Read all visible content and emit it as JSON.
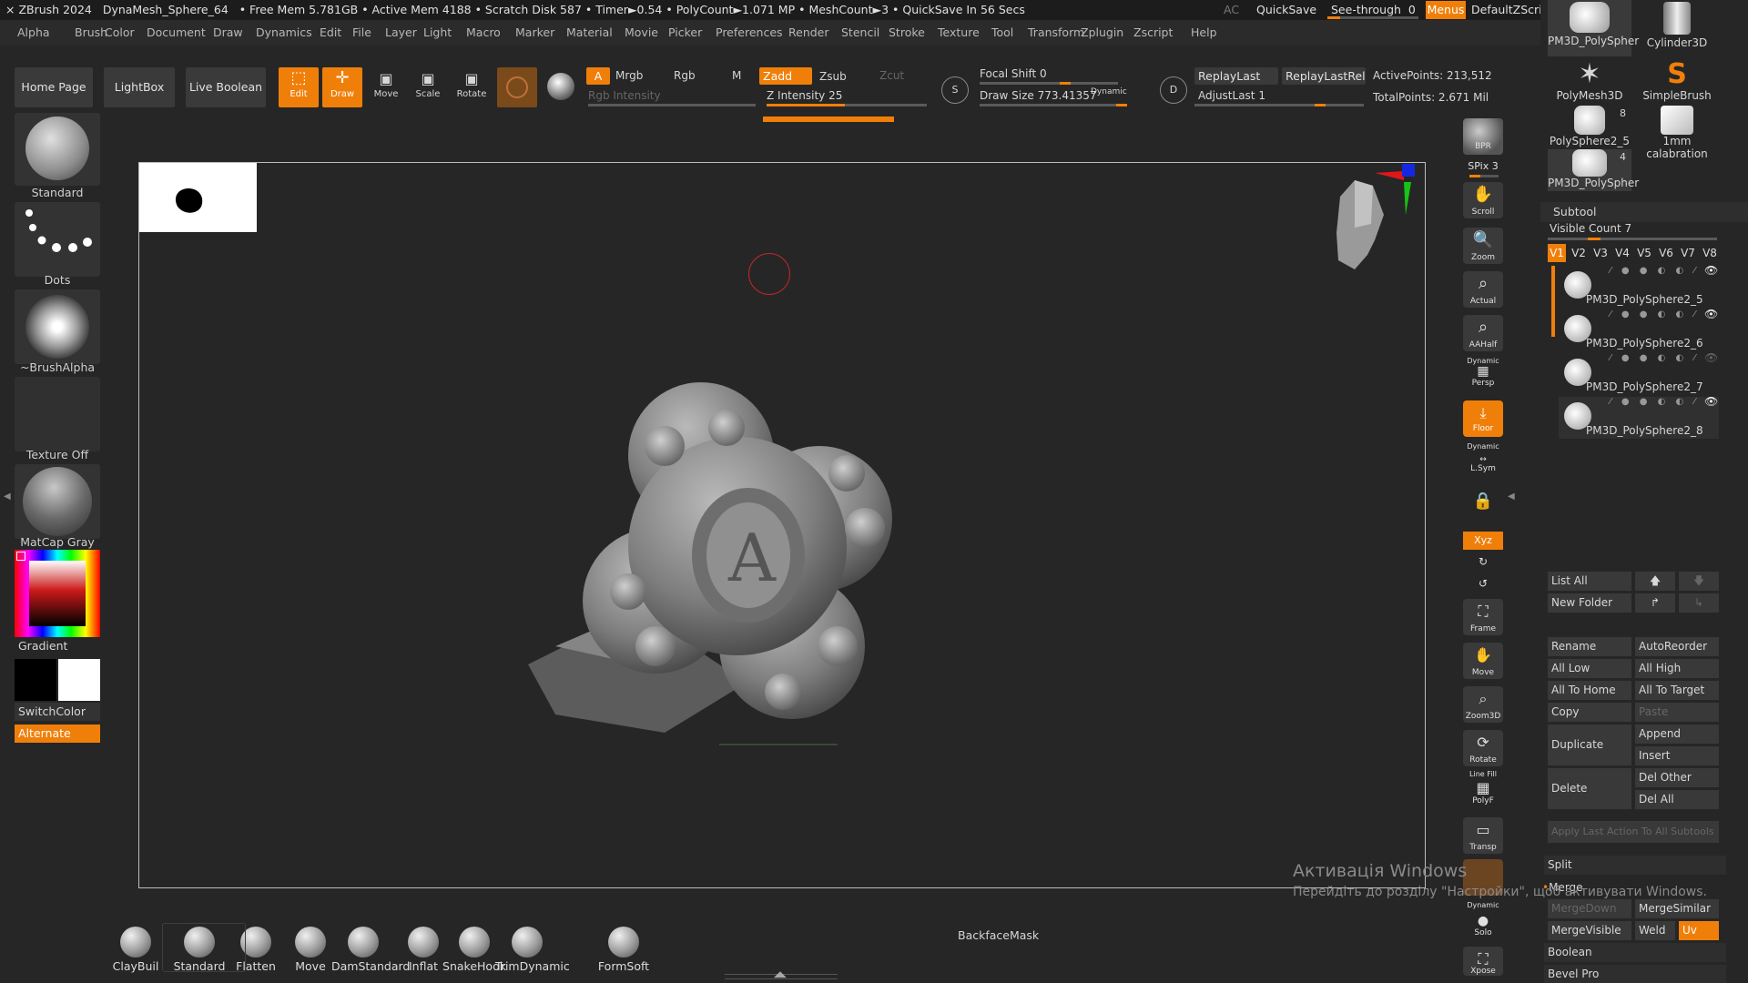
{
  "titlebar": {
    "app": "ZBrush 2024",
    "doc": "DynaMesh_Sphere_64",
    "stats": "• Free Mem 5.781GB • Active Mem 4188 • Scratch Disk 587 • Timer►0.54 • PolyCount►1.071 MP • MeshCount►3 • QuickSave In 56 Secs",
    "ac": "AC",
    "quicksave": "QuickSave",
    "seethrough": "See-through",
    "seethrough_value": "0",
    "seethrough_level": 0.14,
    "menus": "Menus",
    "script": "DefaultZScript"
  },
  "menubar": [
    "Alpha",
    "Brush",
    "Color",
    "Document",
    "Draw",
    "Dynamics",
    "Edit",
    "File",
    "Layer",
    "Light",
    "Macro",
    "Marker",
    "Material",
    "Movie",
    "Picker",
    "Preferences",
    "Render",
    "Stencil",
    "Stroke",
    "Texture",
    "Tool",
    "Transform",
    "Zplugin",
    "Zscript",
    "Help"
  ],
  "toolbar": {
    "home": "Home Page",
    "lightbox": "LightBox",
    "liveboolean": "Live Boolean",
    "edit": "Edit",
    "draw": "Draw",
    "move": "Move",
    "scale": "Scale",
    "rotate": "Rotate",
    "a": "A",
    "mrgb": "Mrgb",
    "rgb": "Rgb",
    "m": "M",
    "zadd": "Zadd",
    "zsub": "Zsub",
    "zcut": "Zcut",
    "rgb_intensity": "Rgb Intensity",
    "z_intensity": "Z Intensity 25",
    "z_intensity_value": 25,
    "focal_shift": "Focal Shift 0",
    "draw_size": "Draw Size 773.41357",
    "dynamic": "Dynamic",
    "replaylast": "ReplayLast",
    "replaylastrel": "ReplayLastRel",
    "adjustlast": "AdjustLast 1",
    "activepoints": "ActivePoints: 213,512",
    "totalpoints": "TotalPoints: 2.671 Mil",
    "s": "S",
    "d": "D"
  },
  "leftshelf": {
    "brush": "Standard",
    "stroke": "Dots",
    "alpha": "~BrushAlpha",
    "texture": "Texture Off",
    "material": "MatCap Gray",
    "gradient": "Gradient",
    "switchcolor": "SwitchColor",
    "alternate": "Alternate"
  },
  "rightshelf": {
    "bpr": "BPR",
    "spix": "SPix 3",
    "scroll": "Scroll",
    "zoom": "Zoom",
    "actual": "Actual",
    "aahalf": "AAHalf",
    "dynamic": "Dynamic",
    "persp": "Persp",
    "floor": "Floor",
    "dynamic2": "Dynamic",
    "lsym": "L.Sym",
    "xyz": "Xyz",
    "frame": "Frame",
    "move": "Move",
    "zoom3d": "Zoom3D",
    "rotate": "Rotate",
    "linefill": "Line Fill",
    "polyf": "PolyF",
    "transp": "Transp",
    "dynamic3": "Dynamic",
    "solo": "Solo",
    "xpose": "Xpose"
  },
  "toolpalette": {
    "items": [
      {
        "label": "PM3D_PolySpher"
      },
      {
        "label": "Cylinder3D"
      },
      {
        "label": "PolyMesh3D"
      },
      {
        "label": "SimpleBrush"
      },
      {
        "label": "PolySphere2_5",
        "count": "8"
      },
      {
        "label": "1mm calabration"
      },
      {
        "label": "PM3D_PolySpher",
        "count": "4"
      }
    ]
  },
  "subtool": {
    "title": "Subtool",
    "visible_count": "Visible Count 7",
    "tabs": [
      "V1",
      "V2",
      "V3",
      "V4",
      "V5",
      "V6",
      "V7",
      "V8"
    ],
    "items": [
      "PM3D_PolySphere2_5",
      "PM3D_PolySphere2_6",
      "PM3D_PolySphere2_7",
      "PM3D_PolySphere2_8"
    ],
    "listall": "List All",
    "newfolder": "New Folder",
    "rename": "Rename",
    "autoreorder": "AutoReorder",
    "alllow": "All Low",
    "allhigh": "All High",
    "alltohome": "All To Home",
    "alltotarget": "All To Target",
    "copy": "Copy",
    "paste": "Paste",
    "duplicate": "Duplicate",
    "append": "Append",
    "insert": "Insert",
    "delete": "Delete",
    "delother": "Del Other",
    "delall": "Del All",
    "applylast": "Apply Last Action To All Subtools",
    "split": "Split",
    "merge": "Merge",
    "mergedown": "MergeDown",
    "mergesimilar": "MergeSimilar",
    "mergevisible": "MergeVisible",
    "weld": "Weld",
    "uv": "Uv",
    "boolean": "Boolean",
    "bevelpro": "Bevel Pro"
  },
  "bottomshelf": {
    "brushes": [
      "ClayBuil",
      "Standard",
      "Flatten",
      "Move",
      "DamStandard",
      "Inflat",
      "SnakeHook",
      "TrimDynamic",
      "FormSoft"
    ],
    "backfacemask": "BackfaceMask"
  },
  "watermark": {
    "line1": "Активація Windows",
    "line2": "Перейдіть до розділу \"Настройки\", щоб активувати Windows."
  }
}
